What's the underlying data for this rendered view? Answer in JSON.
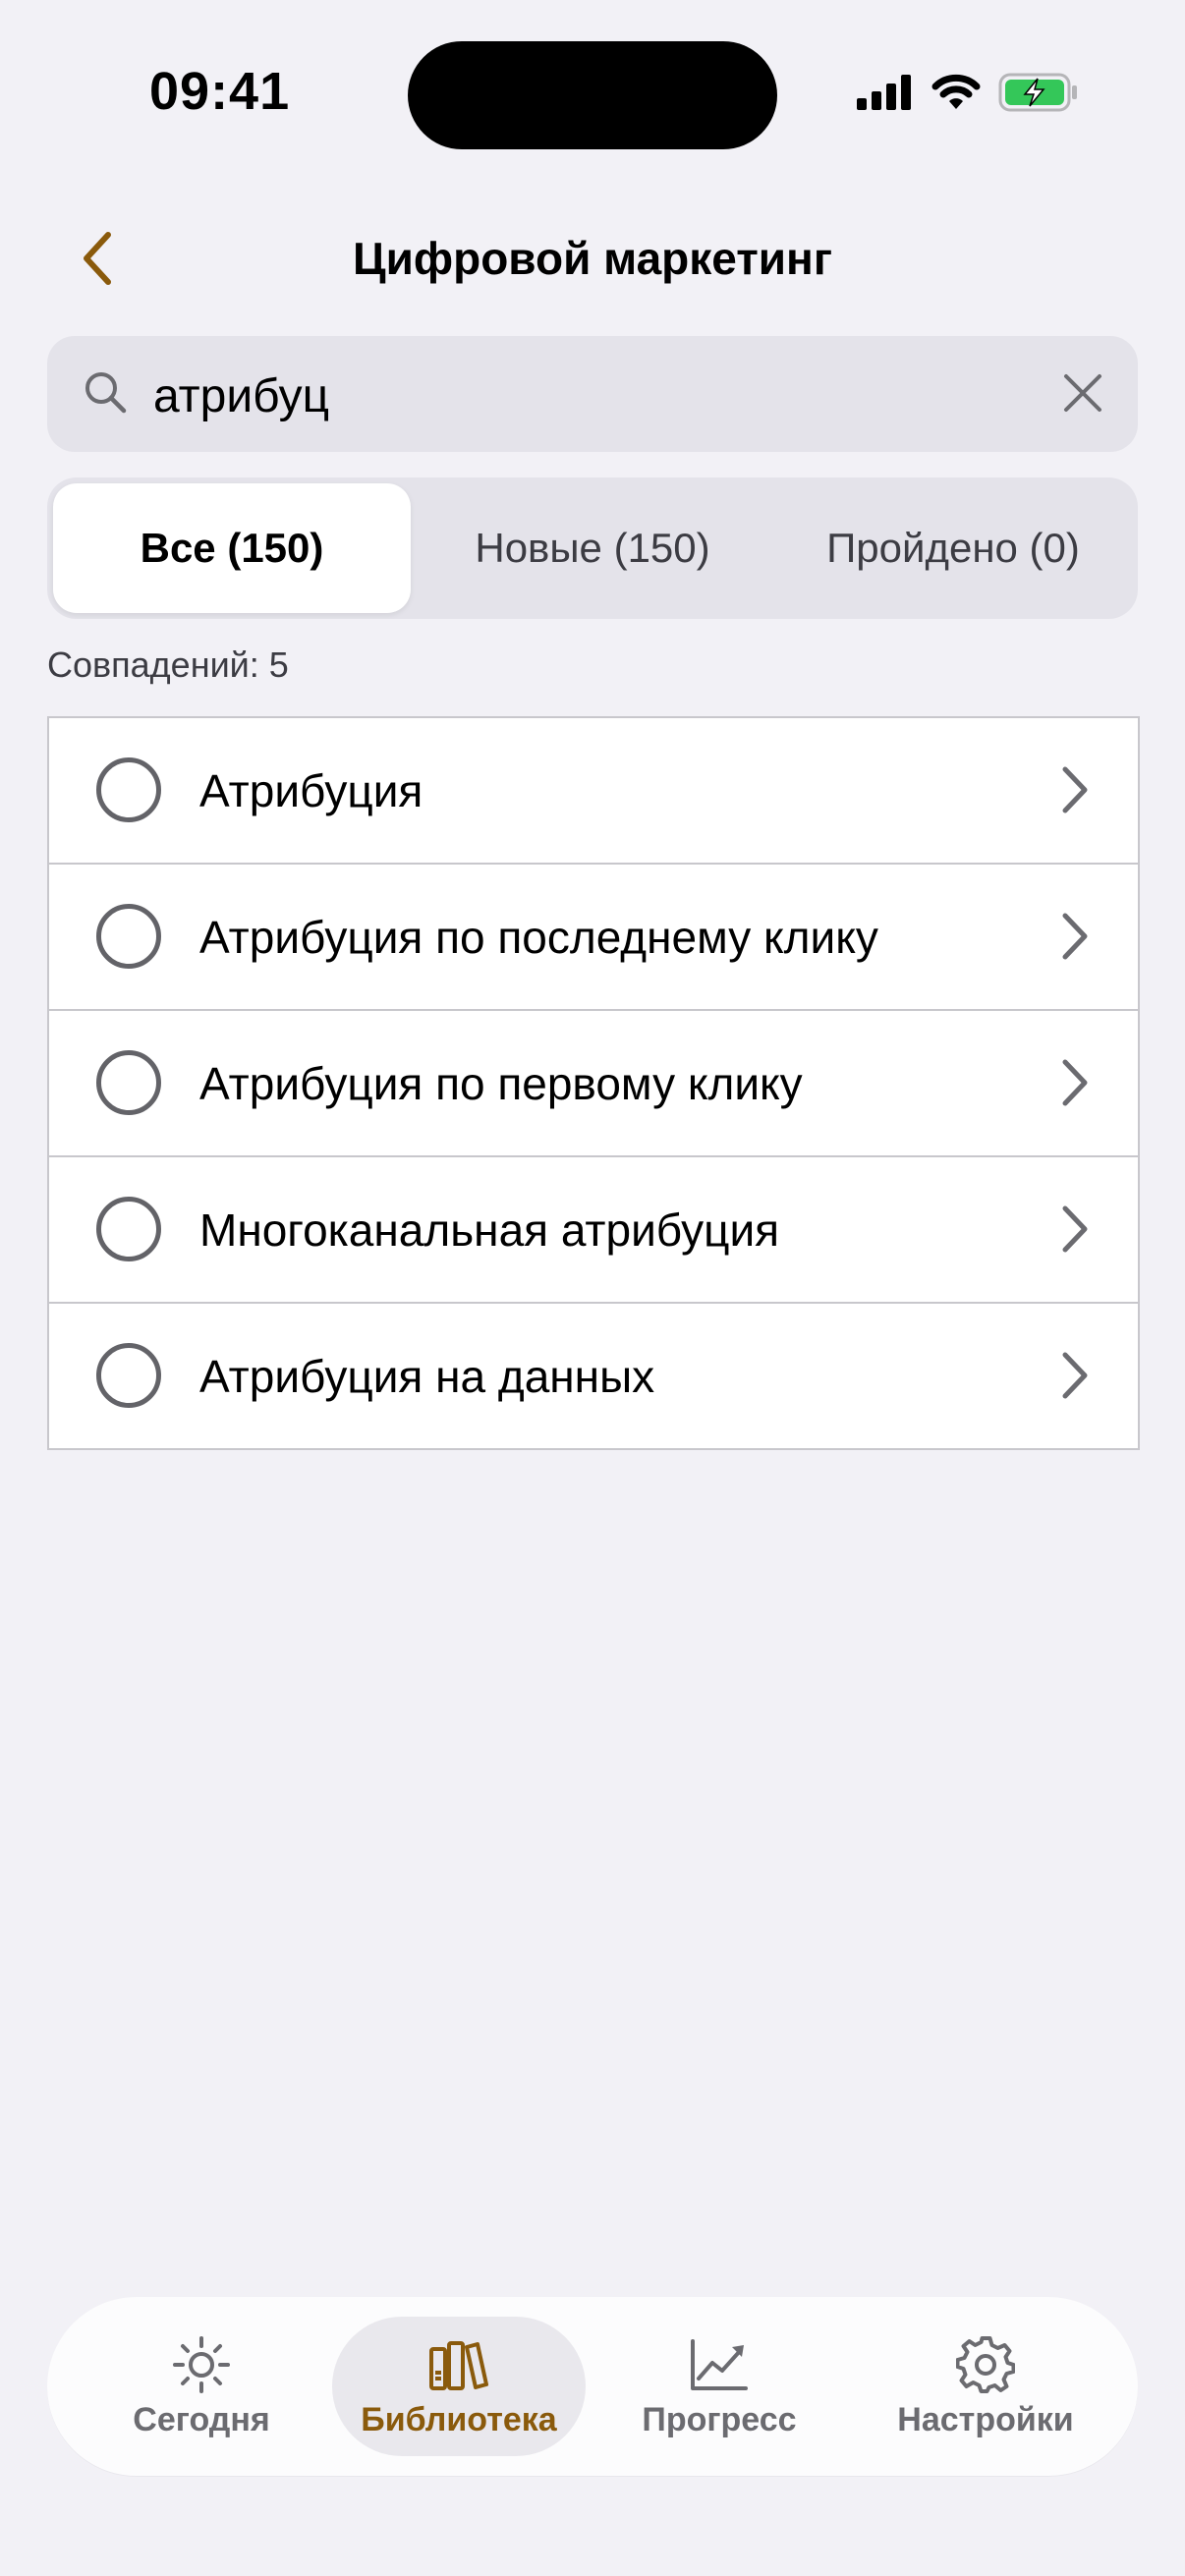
{
  "status_bar": {
    "time": "09:41"
  },
  "nav": {
    "title": "Цифровой маркетинг",
    "back_icon": "chevron-left-icon"
  },
  "search": {
    "value": "атрибуц",
    "icon": "search-icon",
    "clear_icon": "close-icon"
  },
  "segments": [
    {
      "label": "Все (150)",
      "active": true
    },
    {
      "label": "Новые (150)",
      "active": false
    },
    {
      "label": "Пройдено (0)",
      "active": false
    }
  ],
  "matches_label": "Совпадений: 5",
  "items": [
    {
      "label": "Атрибуция"
    },
    {
      "label": "Атрибуция по последнему клику"
    },
    {
      "label": "Атрибуция по первому клику"
    },
    {
      "label": "Многоканальная атрибуция"
    },
    {
      "label": "Атрибуция на данных"
    }
  ],
  "tabbar": {
    "tabs": [
      {
        "label": "Сегодня",
        "icon": "sun-icon",
        "active": false
      },
      {
        "label": "Библиотека",
        "icon": "books-icon",
        "active": true
      },
      {
        "label": "Прогресс",
        "icon": "chart-icon",
        "active": false
      },
      {
        "label": "Настройки",
        "icon": "gear-icon",
        "active": false
      }
    ]
  },
  "colors": {
    "accent": "#8a5a0c",
    "background": "#f2f1f6",
    "battery_green": "#34c759"
  }
}
